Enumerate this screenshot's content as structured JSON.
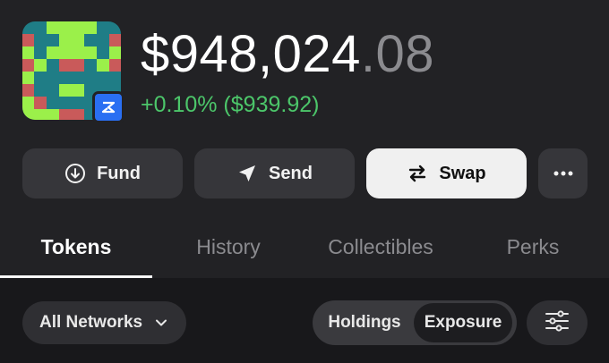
{
  "header": {
    "balance_main": "$948,024",
    "balance_cents": ".08",
    "change": "+0.10% ($939.92)",
    "change_color": "#4cc66a",
    "avatar_colors": [
      "#1f7d86",
      "#9bf04a",
      "#c95a5a"
    ],
    "avatar_badge_icon": "chain-logo-icon",
    "avatar_badge_color": "#2a6ff2"
  },
  "actions": {
    "fund_label": "Fund",
    "fund_icon": "arrow-down-circle-icon",
    "send_label": "Send",
    "send_icon": "paper-plane-icon",
    "swap_label": "Swap",
    "swap_icon": "swap-arrows-icon",
    "more_icon": "more-dots-icon"
  },
  "tabs": [
    {
      "label": "Tokens",
      "active": true
    },
    {
      "label": "History",
      "active": false
    },
    {
      "label": "Collectibles",
      "active": false
    },
    {
      "label": "Perks",
      "active": false
    }
  ],
  "filters": {
    "network_label": "All Networks",
    "network_icon": "chevron-down-icon",
    "view_options": [
      "Holdings",
      "Exposure"
    ],
    "view_selected": "Exposure",
    "filter_icon": "sliders-icon"
  }
}
